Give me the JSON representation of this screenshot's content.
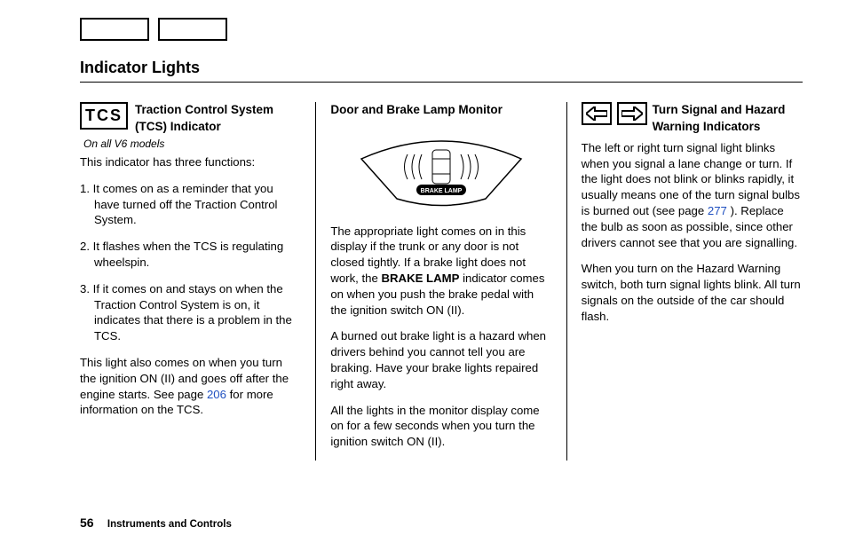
{
  "pageTitle": "Indicator Lights",
  "footer": {
    "pageNumber": "56",
    "section": "Instruments and Controls"
  },
  "col1": {
    "tcsLabel": "TCS",
    "heading": "Traction Control System (TCS) Indicator",
    "subnote": "On all V6 models",
    "intro": "This indicator has three functions:",
    "items": {
      "n1": "1.",
      "t1": "It comes on as a reminder that you have turned off the Traction Control System.",
      "n2": "2.",
      "t2": "It flashes when the TCS is regulating wheelspin.",
      "n3": "3.",
      "t3": "If it comes on and stays on when the Traction Control System is on, it indicates that there is a problem in the TCS."
    },
    "para2a": "This light also comes on when you turn the ignition ON (II) and goes off after the engine starts. See page ",
    "para2link": "206",
    "para2b": " for more information on the TCS."
  },
  "col2": {
    "heading": "Door and Brake Lamp Monitor",
    "figureLabel": "BRAKE LAMP",
    "p1a": "The appropriate light comes on in this display if the trunk or any door is not closed tightly. If a brake light does not work, the ",
    "p1bold": "BRAKE LAMP",
    "p1b": " indicator comes on when you push the brake pedal with the ignition switch ON (II).",
    "p2": "A burned out brake light is a hazard when drivers behind you cannot tell you are braking. Have your brake lights repaired right away.",
    "p3": "All the lights in the monitor display come on for a few seconds when you turn the ignition switch ON (II)."
  },
  "col3": {
    "heading": "Turn Signal and Hazard Warning Indicators",
    "p1a": "The left or right turn signal light blinks when you signal a lane change or turn. If the light does not blink or blinks rapidly, it usually means one of the turn signal bulbs is burned out (see page ",
    "p1link": "277",
    "p1b": " ). Replace the bulb as soon as possible, since other drivers cannot see that you are signalling.",
    "p2": "When you turn on the Hazard Warning switch, both turn signal lights blink. All turn signals on the outside of the car should flash."
  }
}
